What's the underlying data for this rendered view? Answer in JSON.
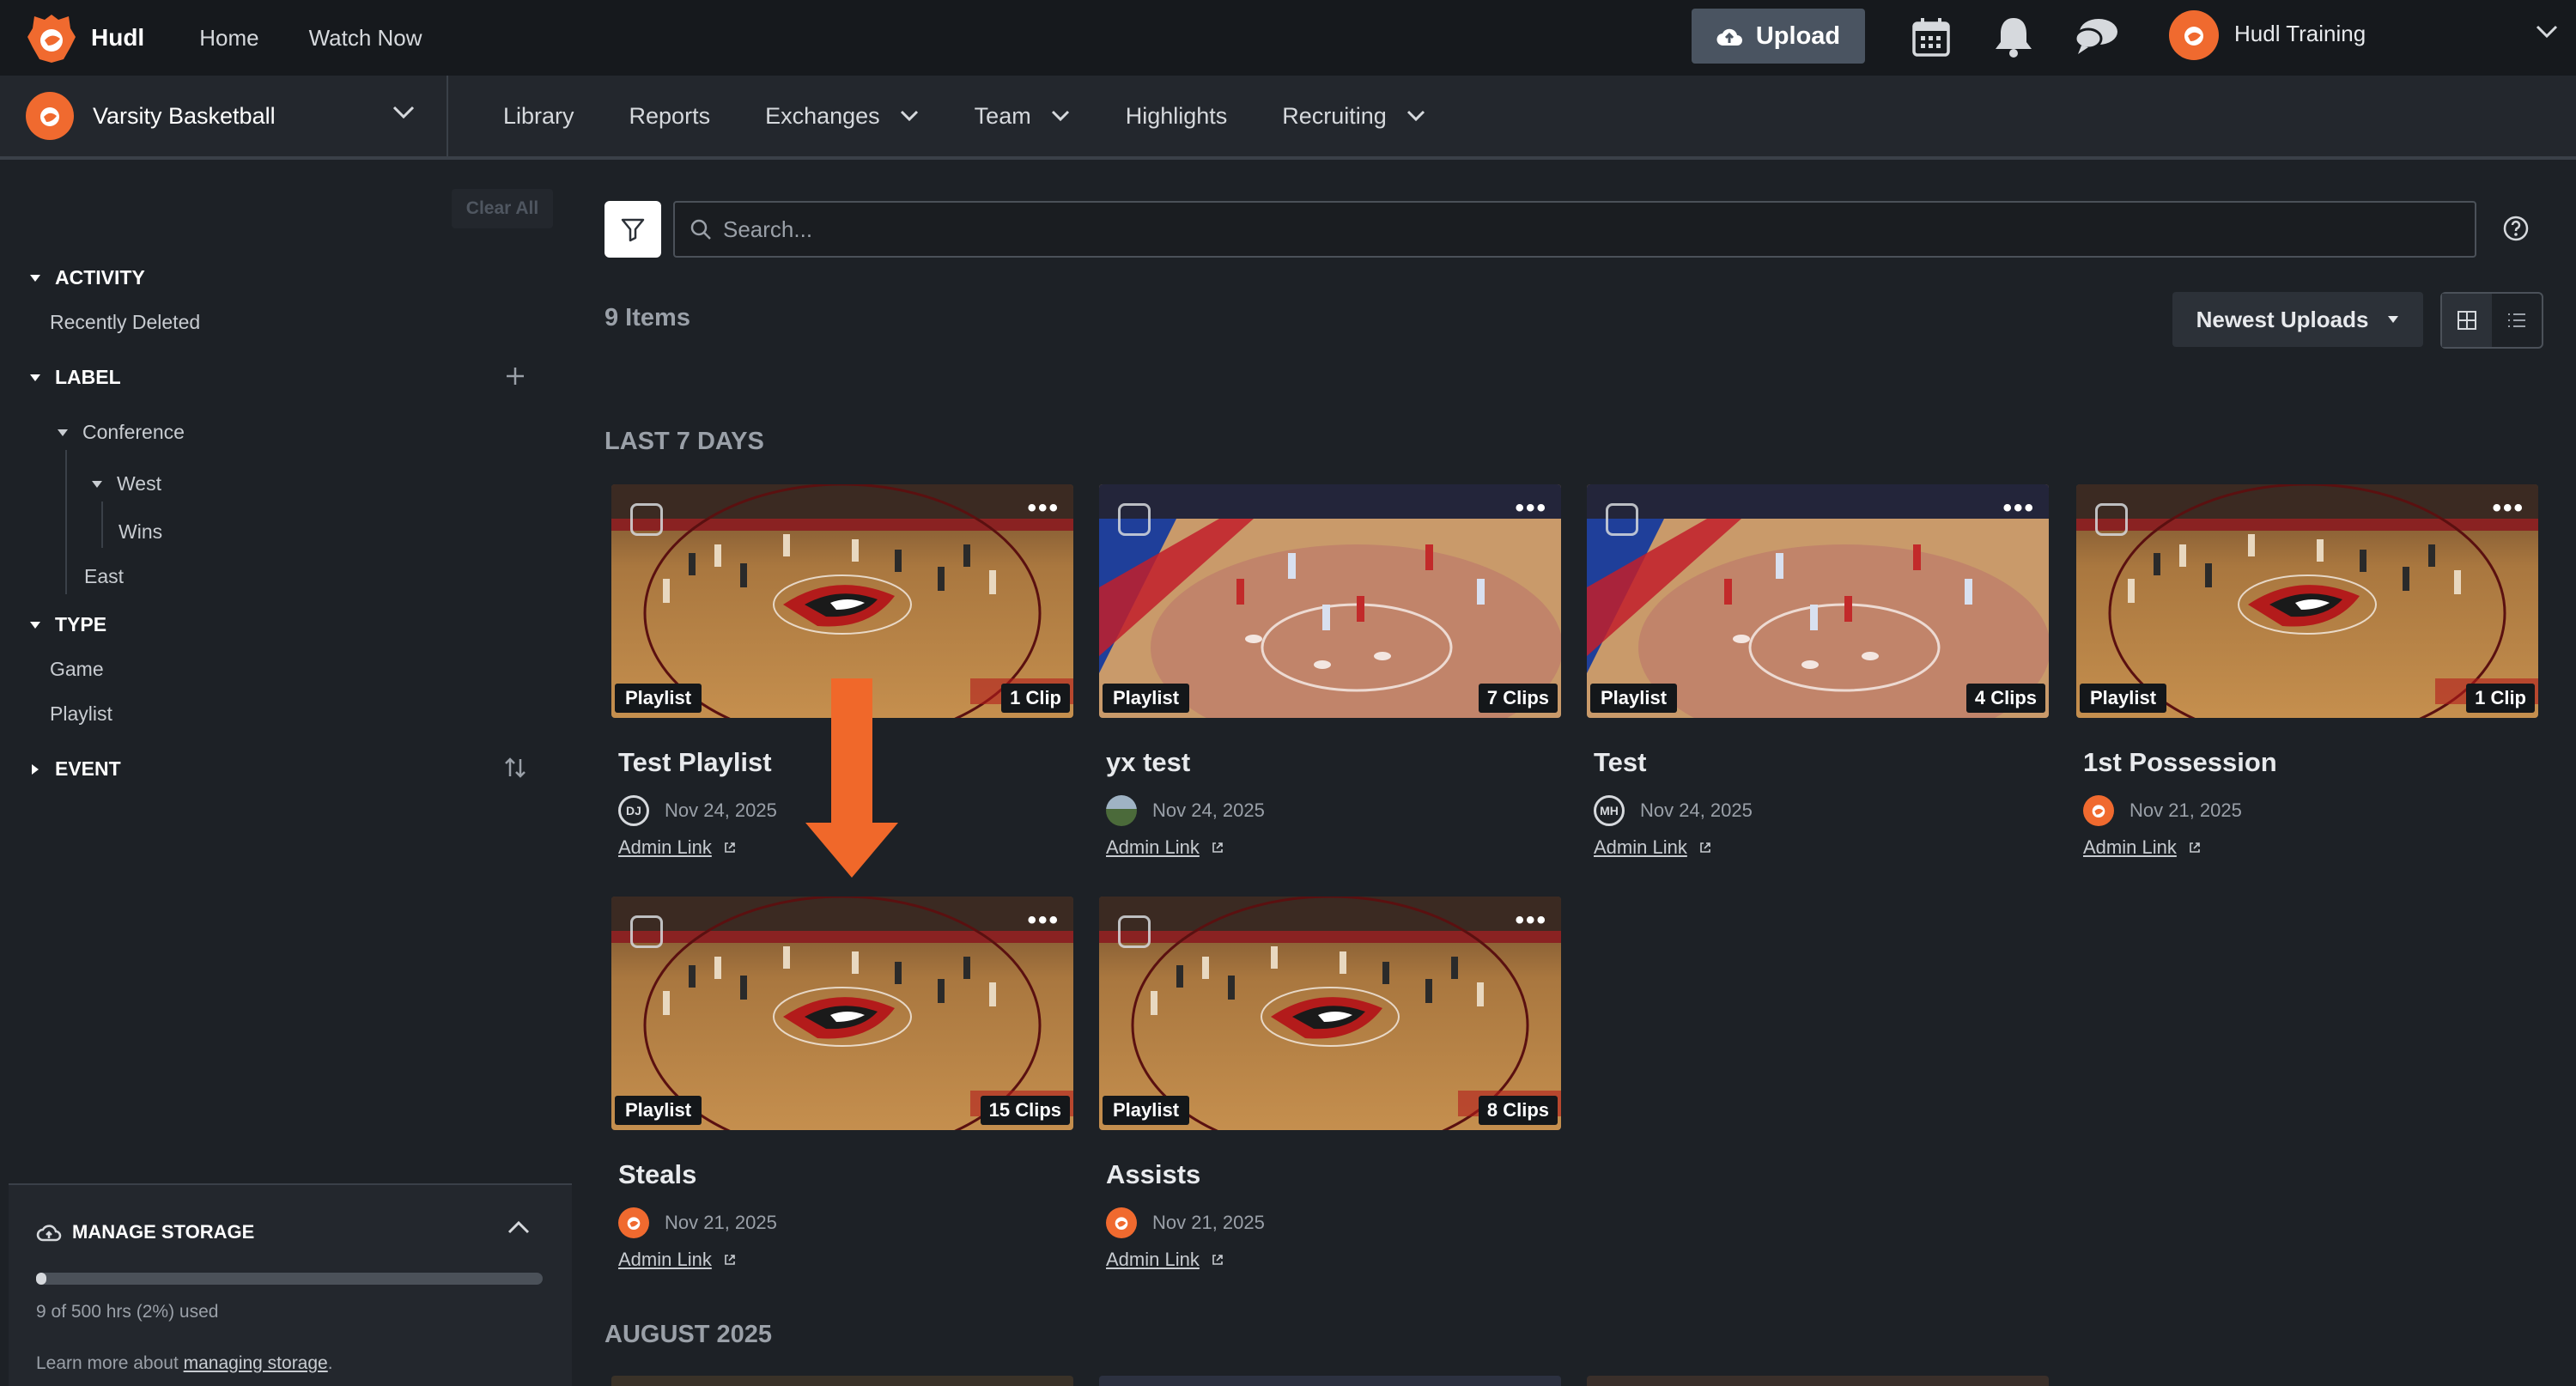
{
  "header": {
    "brand": "Hudl",
    "nav": [
      "Home",
      "Watch Now"
    ],
    "upload_label": "Upload",
    "user_name": "Hudl Training"
  },
  "subnav": {
    "team_name": "Varsity Basketball",
    "items": [
      "Library",
      "Reports",
      "Exchanges",
      "Team",
      "Highlights",
      "Recruiting"
    ]
  },
  "sidebar": {
    "clear_all": "Clear All",
    "activity": {
      "label": "ACTIVITY",
      "items": [
        "Recently Deleted"
      ]
    },
    "label": {
      "label": "LABEL",
      "conference": "Conference",
      "west": "West",
      "wins": "Wins",
      "east": "East"
    },
    "type": {
      "label": "TYPE",
      "items": [
        "Game",
        "Playlist"
      ]
    },
    "event": {
      "label": "EVENT"
    },
    "storage": {
      "title": "MANAGE STORAGE",
      "used_text": "9 of 500 hrs (2%) used",
      "used_fraction": 0.02,
      "learn_prefix": "Learn more about ",
      "learn_link": "managing storage",
      "learn_suffix": "."
    }
  },
  "main": {
    "search_placeholder": "Search...",
    "items_count": "9 Items",
    "sort_label": "Newest Uploads",
    "sections": [
      "LAST 7 DAYS",
      "AUGUST 2025"
    ],
    "cards": [
      {
        "type": "Playlist",
        "clips": "1 Clip",
        "title": "Test Playlist",
        "date": "Nov 24, 2025",
        "avatar": "DJ",
        "link": "Admin Link"
      },
      {
        "type": "Playlist",
        "clips": "7 Clips",
        "title": "yx test",
        "date": "Nov 24, 2025",
        "avatar": "",
        "link": "Admin Link"
      },
      {
        "type": "Playlist",
        "clips": "4 Clips",
        "title": "Test",
        "date": "Nov 24, 2025",
        "avatar": "MH",
        "link": "Admin Link"
      },
      {
        "type": "Playlist",
        "clips": "1 Clip",
        "title": "1st Possession",
        "date": "Nov 21, 2025",
        "avatar": "",
        "link": "Admin Link"
      },
      {
        "type": "Playlist",
        "clips": "15 Clips",
        "title": "Steals",
        "date": "Nov 21, 2025",
        "avatar": "",
        "link": "Admin Link"
      },
      {
        "type": "Playlist",
        "clips": "8 Clips",
        "title": "Assists",
        "date": "Nov 21, 2025",
        "avatar": "",
        "link": "Admin Link"
      }
    ]
  },
  "colors": {
    "accent": "#f06a2f",
    "background": "#1d2126",
    "topbar": "#16191d"
  },
  "icons": [
    "hudl-logo-icon",
    "upload-cloud-icon",
    "calendar-icon",
    "bell-icon",
    "chat-icon",
    "chevron-down-icon",
    "filter-icon",
    "search-icon",
    "help-icon",
    "grid-view-icon",
    "list-view-icon",
    "plus-icon",
    "sort-icon",
    "storage-cloud-icon",
    "chevron-up-icon",
    "external-link-icon",
    "arrow-down-annotation"
  ]
}
